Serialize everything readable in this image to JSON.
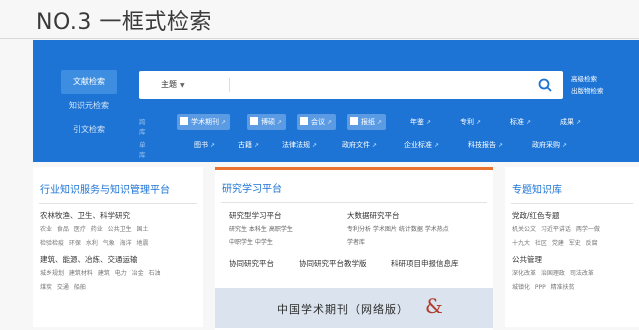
{
  "slide": {
    "title": "NO.3 一框式检索"
  },
  "cnki": {
    "top_text": "",
    "side_tabs": [
      {
        "label": "文献检索",
        "active": true
      },
      {
        "label": "知识元检索",
        "active": false
      },
      {
        "label": "引文检索",
        "active": false
      }
    ],
    "search": {
      "field": "主题",
      "value": "",
      "placeholder": ""
    },
    "adv_links": [
      "高级检索",
      "出版物检索"
    ],
    "row1": {
      "label": "跨库",
      "chips": [
        {
          "label": "学术期刊",
          "checked": true
        },
        {
          "label": "博硕",
          "checked": true
        },
        {
          "label": "会议",
          "checked": true
        },
        {
          "label": "报纸",
          "checked": true
        },
        {
          "label": "年鉴",
          "checked": false
        },
        {
          "label": "专利",
          "checked": false
        },
        {
          "label": "标准",
          "checked": false
        },
        {
          "label": "成果",
          "checked": false
        }
      ]
    },
    "row2": {
      "label": "单库",
      "chips": [
        {
          "label": "图书"
        },
        {
          "label": "古籍"
        },
        {
          "label": "法律法规"
        },
        {
          "label": "政府文件"
        },
        {
          "label": "企业标准"
        },
        {
          "label": "科技报告"
        },
        {
          "label": "政府采购"
        }
      ]
    }
  },
  "panels": {
    "p1": {
      "title": "行业知识服务与知识管理平台",
      "groups": [
        {
          "title": "农林牧渔、卫生、科学研究",
          "links1": "农业 食品 医疗 药业 公共卫生 国土",
          "links2": "检验检疫 环保 水利 气象 海洋 地震"
        },
        {
          "title": "建筑、能源、冶炼、交通运输",
          "links1": "城乡规划 建筑材料 建筑 电力 冶金 石油",
          "links2": "煤炭 交通 船舶"
        }
      ]
    },
    "p2": {
      "title": "研究学习平台",
      "left_head": "研究型学习平台",
      "left_links1": "研究生 本科生 高职学生",
      "left_links2": "中职学生 中学生",
      "right_head": "大数据研究平台",
      "right_links1": "专利分析 学术图片 统计数据 学术热点",
      "right_links2": "学者库",
      "bottom_items": [
        "协同研究平台",
        "协同研究平台教学版",
        "科研项目申报信息库"
      ],
      "banner_text": "中国学术期刊（网络版）",
      "banner_amp": "&"
    },
    "p3": {
      "title": "专题知识库",
      "g1_title": "党政/红色专题",
      "g1_links1": "机关公文 习近平讲话 两学一做",
      "g1_links2": "十九大 社区 党建 军史 反腐",
      "g2_title": "公共管理",
      "g2_links1": "深化改革 治国理政 司法改革",
      "g2_links2": "城镇化 PPP 精准扶贫"
    }
  },
  "colors": {
    "brand_blue": "#1d74d4",
    "accent_orange": "#e9722e"
  }
}
